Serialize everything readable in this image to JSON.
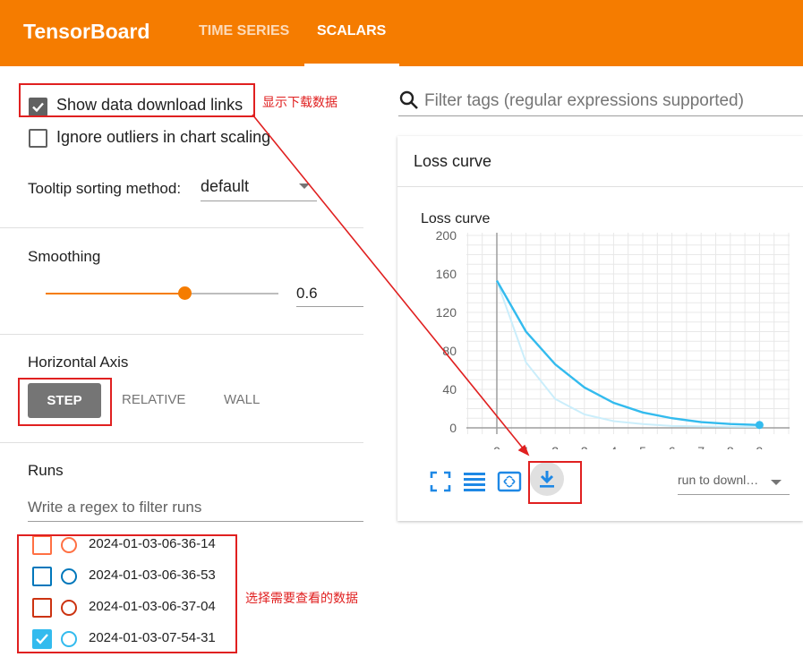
{
  "header": {
    "brand": "TensorBoard",
    "tabs": [
      {
        "label": "TIME SERIES",
        "active": false
      },
      {
        "label": "SCALARS",
        "active": true
      }
    ],
    "color": "#f57c00"
  },
  "sidebar": {
    "show_download_links": {
      "label": "Show data download links",
      "checked": true
    },
    "ignore_outliers": {
      "label": "Ignore outliers in chart scaling",
      "checked": false
    },
    "tooltip_sorting": {
      "label": "Tooltip sorting method:",
      "value": "default"
    },
    "smoothing": {
      "label": "Smoothing",
      "value": "0.6",
      "fraction": 0.6
    },
    "horizontal_axis": {
      "label": "Horizontal Axis",
      "options": [
        "STEP",
        "RELATIVE",
        "WALL"
      ],
      "selected": "STEP"
    },
    "runs": {
      "label": "Runs",
      "filter_placeholder": "Write a regex to filter runs",
      "items": [
        {
          "name": "2024-01-03-06-36-14",
          "color": "#ff7043",
          "checked": false
        },
        {
          "name": "2024-01-03-06-36-53",
          "color": "#0077bb",
          "checked": false
        },
        {
          "name": "2024-01-03-06-37-04",
          "color": "#cc3311",
          "checked": false
        },
        {
          "name": "2024-01-03-07-54-31",
          "color": "#33bbee",
          "checked": true
        }
      ]
    }
  },
  "main": {
    "filter_placeholder": "Filter tags (regular expressions supported)",
    "card": {
      "title": "Loss curve",
      "chart_title": "Loss curve",
      "dropdown_value": "run to downl…",
      "icons": [
        "fullscreen-icon",
        "lines-icon",
        "fit-domain-icon",
        "download-icon"
      ]
    }
  },
  "annotations": {
    "show_download": "显示下载数据",
    "select_runs": "选择需要查看的数据"
  },
  "chart_data": {
    "type": "line",
    "title": "Loss curve",
    "x": [
      0,
      1,
      2,
      3,
      4,
      5,
      6,
      7,
      8,
      9
    ],
    "xlim": [
      0,
      9
    ],
    "ylim": [
      0,
      200
    ],
    "yticks": [
      0,
      40,
      80,
      120,
      160,
      200
    ],
    "xticks": [
      0,
      1,
      2,
      3,
      4,
      5,
      6,
      7,
      8,
      9
    ],
    "grid": true,
    "series": [
      {
        "values": [
          153,
          100,
          66,
          42,
          26,
          16,
          10,
          6,
          4,
          3
        ],
        "color": "#33bbee",
        "style": "smoothed"
      },
      {
        "values": [
          153,
          68,
          30,
          14,
          7,
          4,
          2,
          1.5,
          1.2,
          1
        ],
        "color": "#cbeefb",
        "style": "raw"
      }
    ]
  }
}
